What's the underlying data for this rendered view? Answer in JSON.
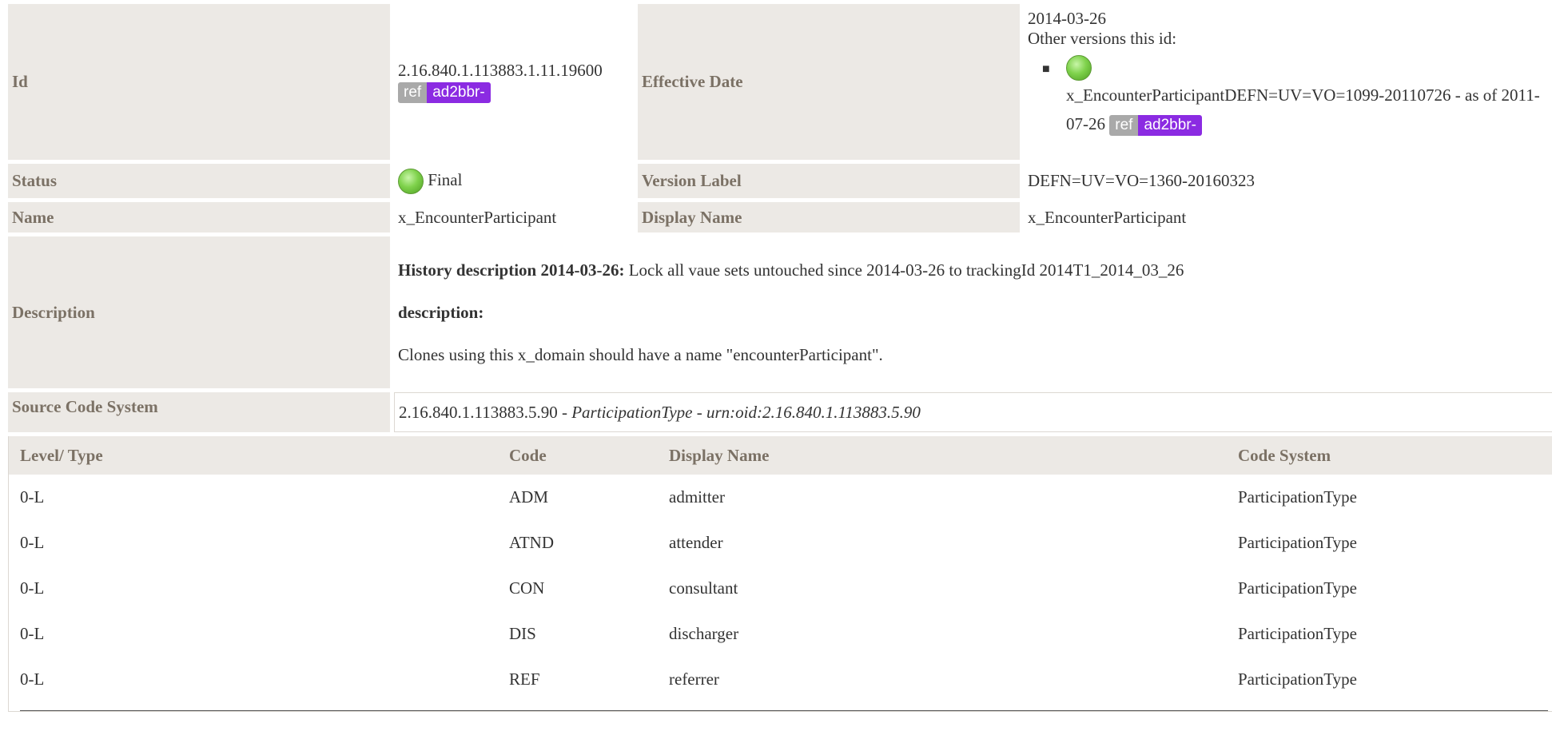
{
  "meta": {
    "id_label": "Id",
    "id_value": "2.16.840.1.113883.1.11.19600",
    "id_badge": {
      "left": "ref",
      "right": "ad2bbr-"
    },
    "effective_date_label": "Effective Date",
    "effective_date_value": "2014-03-26",
    "other_versions_label": "Other versions this id:",
    "other_version": {
      "text": "x_EncounterParticipantDEFN=UV=VO=1099-20110726 - as of 2011-07-26",
      "badge": {
        "left": "ref",
        "right": "ad2bbr-"
      }
    },
    "status_label": "Status",
    "status_value": "Final",
    "version_label_label": "Version Label",
    "version_label_value": "DEFN=UV=VO=1360-20160323",
    "name_label": "Name",
    "name_value": "x_EncounterParticipant",
    "display_name_label": "Display Name",
    "display_name_value": "x_EncounterParticipant",
    "description_label": "Description",
    "history_title": "History description 2014-03-26:",
    "history_text": "Lock all vaue sets untouched since 2014-03-26 to trackingId 2014T1_2014_03_26",
    "description_title": "description:",
    "description_text": "Clones using this x_domain should have a name \"encounterParticipant\".",
    "source_label": "Source Code System",
    "source_oid": "2.16.840.1.113883.5.90",
    "source_sep": "-",
    "source_name": "ParticipationType",
    "source_urn": "urn:oid:2.16.840.1.113883.5.90"
  },
  "concepts": {
    "headers": [
      "Level/ Type",
      "Code",
      "Display Name",
      "Code System"
    ],
    "rows": [
      [
        "0-L",
        "ADM",
        "admitter",
        "ParticipationType"
      ],
      [
        "0-L",
        "ATND",
        "attender",
        "ParticipationType"
      ],
      [
        "0-L",
        "CON",
        "consultant",
        "ParticipationType"
      ],
      [
        "0-L",
        "DIS",
        "discharger",
        "ParticipationType"
      ],
      [
        "0-L",
        "REF",
        "referrer",
        "ParticipationType"
      ]
    ]
  },
  "colors": {
    "label_bg": "#ece9e5",
    "label_text": "#7b7165",
    "badge_ref": "#a9a9a9",
    "badge_id": "#8b2be2",
    "status_final": "#7fd24c"
  }
}
